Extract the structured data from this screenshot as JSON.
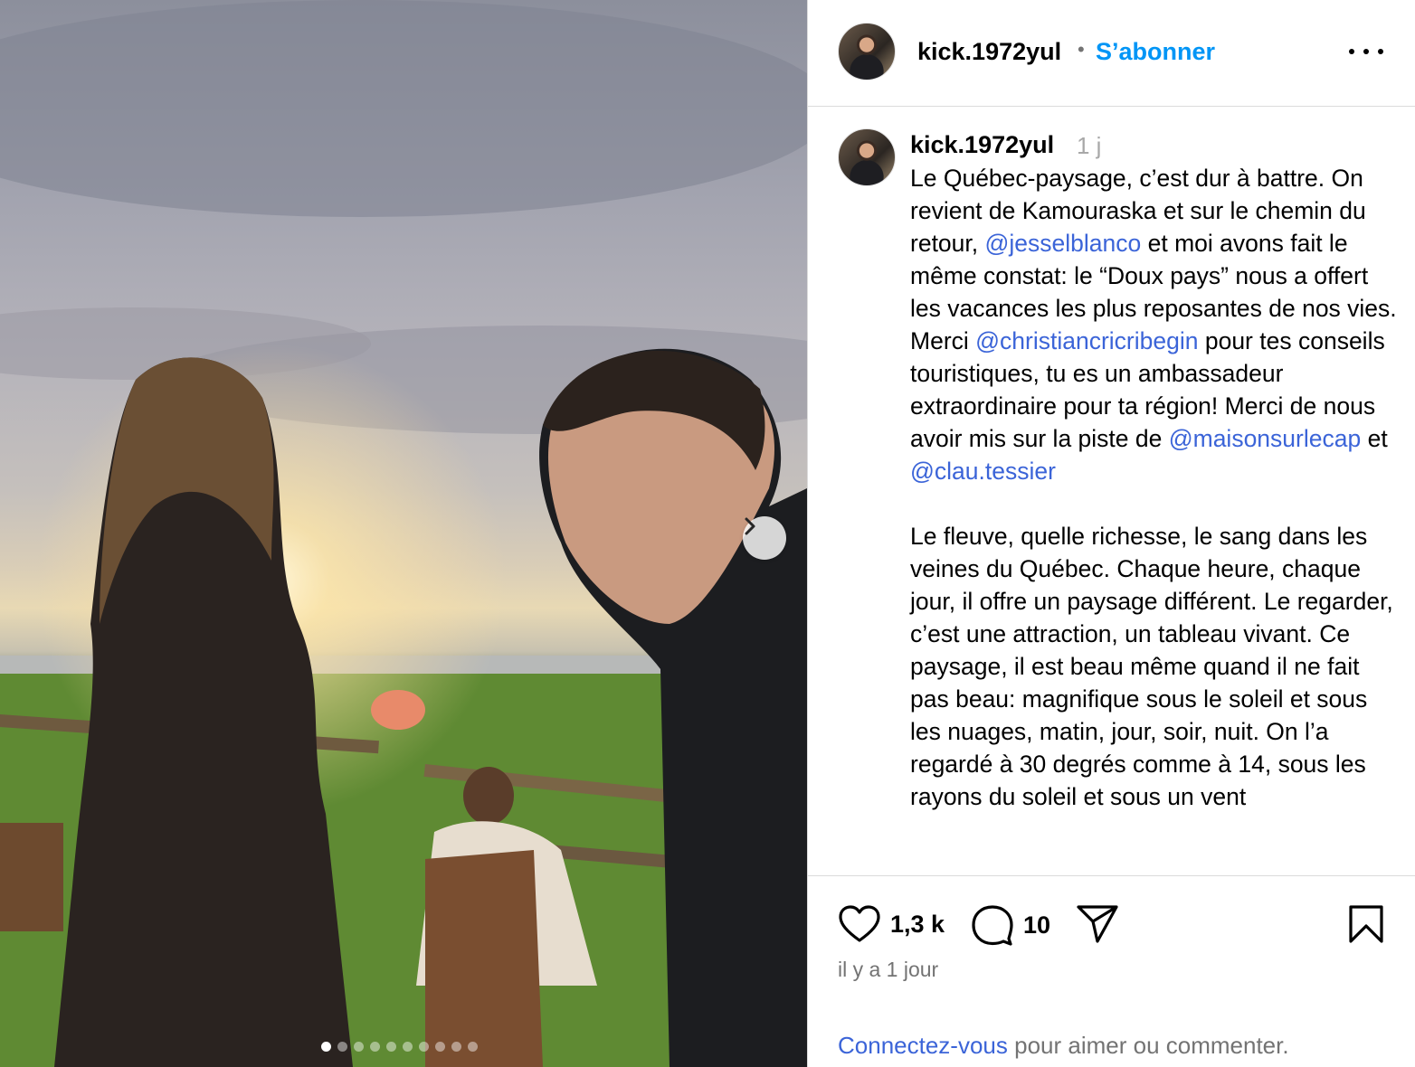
{
  "post": {
    "username": "kick.1972yul",
    "follow_label": "S’abonner",
    "separator": "•",
    "time_short": "1 j",
    "caption": {
      "p1": [
        "Le Québec-paysage, c’est dur à battre. On revient de Kamouraska et sur le chemin du retour, ",
        "@jesselblanco",
        " et moi avons fait le même constat: le “Doux pays” nous a offert les vacances les plus reposantes de nos vies. Merci ",
        "@christiancricribegin",
        " pour tes conseils touristiques, tu es un ambassadeur extraordinaire pour ta région! Merci de nous avoir mis sur la piste de ",
        "@maisonsurlecap",
        " et ",
        "@clau.tessier"
      ],
      "p2": "Le fleuve, quelle richesse, le sang dans les veines du Québec. Chaque heure, chaque jour, il offre un paysage différent. Le regarder, c’est une attraction, un tableau vivant. Ce paysage, il est beau même quand il ne fait pas beau: magnifique sous le soleil et sous les nuages, matin, jour, soir, nuit. On l’a regardé à 30 degrés comme à 14, sous les rayons du soleil et sous un vent"
    },
    "likes": "1,3 k",
    "comments": "10",
    "timestamp": "il y a 1 jour",
    "login_link": "Connectez-vous",
    "login_text": " pour aimer ou commenter."
  },
  "carousel": {
    "slide_count": 10,
    "active_index": 0
  },
  "icons": {
    "more": "more-options-icon",
    "next": "chevron-right-icon",
    "like": "heart-icon",
    "comment": "comment-bubble-icon",
    "share": "paper-plane-icon",
    "save": "bookmark-icon"
  },
  "colors": {
    "accent": "#0095f6",
    "mention": "#3b64d8",
    "muted": "#737373"
  }
}
